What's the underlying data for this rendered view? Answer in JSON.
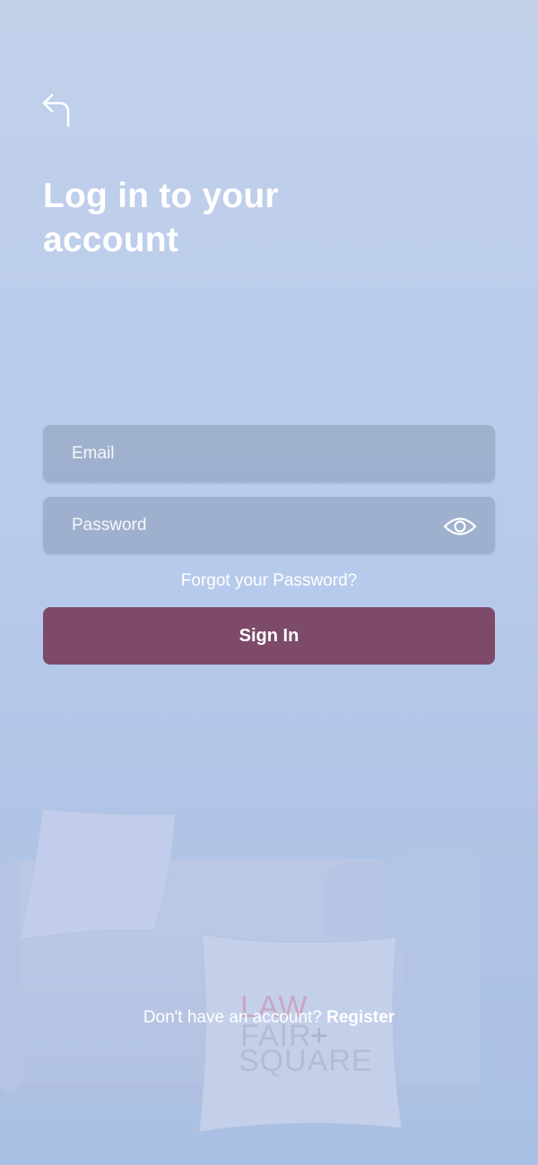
{
  "header": {
    "back_icon": "back-arrow-icon",
    "title": "Log in to your account"
  },
  "form": {
    "email_placeholder": "Email",
    "password_placeholder": "Password",
    "password_toggle_icon": "eye-icon",
    "forgot_password_label": "Forgot your Password?",
    "sign_in_label": "Sign In"
  },
  "footer": {
    "prompt": "Don't have an account?",
    "register_label": "Register"
  },
  "background": {
    "pillow_logo": "LAW FAIR + SQUARE"
  },
  "colors": {
    "background": "#b8cbec",
    "input_fill": "#8f9fbc",
    "primary_button": "#7d4a69",
    "text": "#ffffff"
  }
}
